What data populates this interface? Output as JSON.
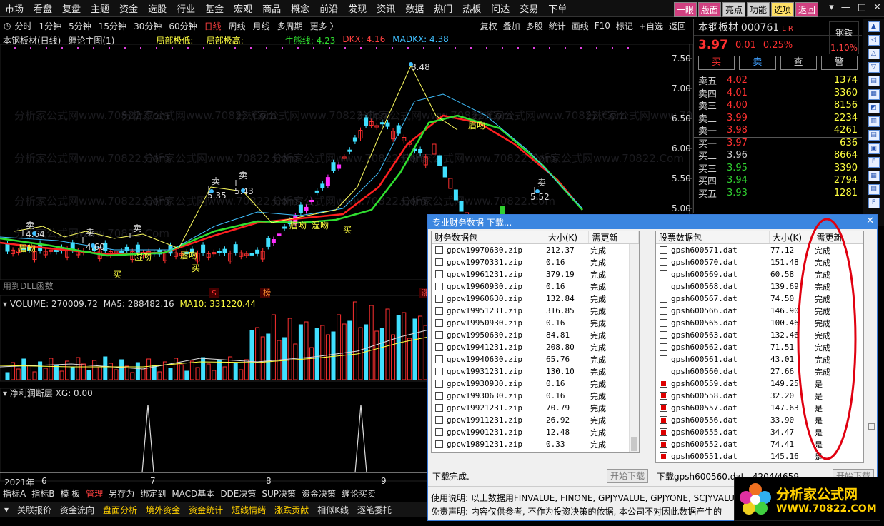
{
  "menu": [
    "市场",
    "看盘",
    "复盘",
    "主题",
    "资金",
    "选股",
    "行业",
    "基金",
    "宏观",
    "商品",
    "概念",
    "前沿",
    "发现",
    "资讯",
    "数据",
    "热门",
    "热板",
    "问达",
    "交易",
    "下单"
  ],
  "top_buttons": [
    {
      "label": "一眼",
      "style": "hi"
    },
    {
      "label": "版面",
      "style": "hi"
    },
    {
      "label": "亮点",
      "style": ""
    },
    {
      "label": "功能",
      "style": ""
    },
    {
      "label": "选项",
      "style": "y"
    },
    {
      "label": "返回",
      "style": "hi"
    }
  ],
  "periods": [
    "分时",
    "1分钟",
    "5分钟",
    "15分钟",
    "30分钟",
    "60分钟",
    "日线",
    "周线",
    "月线",
    "多周期",
    "更多 〉"
  ],
  "active_period": "日线",
  "tools": [
    "复权",
    "叠加",
    "多股",
    "统计",
    "画线",
    "F10",
    "标记",
    "+自选",
    "返回"
  ],
  "chart_header": {
    "stock": "本钢板材(日线)",
    "indicator": "缠论主图(1)",
    "low": "局部极低: -",
    "high": "局部极高: -",
    "niu": "牛熊线: 4.23",
    "dkx": "DKX: 4.16",
    "madkx": "MADKX: 4.38"
  },
  "price_axis": [
    "7.50",
    "7.00",
    "6.50",
    "6.00",
    "5.50",
    "5.00"
  ],
  "annotations": {
    "peak": "8.48",
    "sell": "卖",
    "buy": "买",
    "kiss1": "眉吻",
    "kiss2": "湿吻",
    "kiss3": "唇吻",
    "p1": "4.64",
    "p2": "4.60",
    "p3": "5.35",
    "p4": "5.43",
    "p5": "5.52",
    "dll": "用到DLL函数",
    "m1": "$",
    "m2": "榜",
    "m3": "涨"
  },
  "volume": {
    "label": "VOLUME: 270009.72",
    "ma5": "MA5: 288482.16",
    "ma10": "MA10: 331220.44"
  },
  "indicator2": {
    "label": "净利润断层 XG: 0.00"
  },
  "dates": [
    "2021年",
    "6",
    "7",
    "8",
    "9"
  ],
  "quote": {
    "name": "本钢板材",
    "code": "000761",
    "lr": "L R",
    "price": "3.97",
    "change": "0.01",
    "pct": "0.25%",
    "sector": "钢铁",
    "sector_pct": "1.10%"
  },
  "trade_buttons": [
    "买",
    "卖",
    "查",
    "警"
  ],
  "orderbook": [
    {
      "level": "卖五",
      "price": "4.02",
      "vol": "1374",
      "color": "#ff3030"
    },
    {
      "level": "卖四",
      "price": "4.01",
      "vol": "3360",
      "color": "#ff3030"
    },
    {
      "level": "卖三",
      "price": "4.00",
      "vol": "8156",
      "color": "#ff3030"
    },
    {
      "level": "卖二",
      "price": "3.99",
      "vol": "2234",
      "color": "#ff3030"
    },
    {
      "level": "卖一",
      "price": "3.98",
      "vol": "4261",
      "color": "#ff3030"
    },
    {
      "level": "买一",
      "price": "3.97",
      "vol": "636",
      "color": "#ff3030"
    },
    {
      "level": "买二",
      "price": "3.96",
      "vol": "8664",
      "color": "#cccccc"
    },
    {
      "level": "买三",
      "price": "3.95",
      "vol": "3390",
      "color": "#30d030"
    },
    {
      "level": "买四",
      "price": "3.94",
      "vol": "2794",
      "color": "#30d030"
    },
    {
      "level": "买五",
      "price": "3.93",
      "vol": "1281",
      "color": "#30d030"
    }
  ],
  "bottom_tabs1": [
    "指标A",
    "指标B",
    "模 板",
    "管理",
    "另存为",
    "绑定到",
    "MACD基本",
    "DDE决策",
    "SUP决策",
    "资金决策",
    "缠论买卖"
  ],
  "bottom_tabs2": [
    "关联报价",
    "资金流向",
    "盘面分析",
    "境外资金",
    "资金统计",
    "短线情绪",
    "涨跌贡献",
    "相似K线",
    "逐笔委托"
  ],
  "dialog": {
    "title": "专业财务数据 下载...",
    "left_headers": [
      "财务数据包",
      "大小(K)",
      "需更新"
    ],
    "right_headers": [
      "股票数据包",
      "大小(K)",
      "需更新"
    ],
    "left_rows": [
      {
        "file": "gpcw19970630.zip",
        "size": "212.37",
        "status": "完成"
      },
      {
        "file": "gpcw19970331.zip",
        "size": "0.16",
        "status": "完成"
      },
      {
        "file": "gpcw19961231.zip",
        "size": "379.19",
        "status": "完成"
      },
      {
        "file": "gpcw19960930.zip",
        "size": "0.16",
        "status": "完成"
      },
      {
        "file": "gpcw19960630.zip",
        "size": "132.84",
        "status": "完成"
      },
      {
        "file": "gpcw19951231.zip",
        "size": "316.85",
        "status": "完成"
      },
      {
        "file": "gpcw19950930.zip",
        "size": "0.16",
        "status": "完成"
      },
      {
        "file": "gpcw19950630.zip",
        "size": "84.81",
        "status": "完成"
      },
      {
        "file": "gpcw19941231.zip",
        "size": "208.80",
        "status": "完成"
      },
      {
        "file": "gpcw19940630.zip",
        "size": "65.76",
        "status": "完成"
      },
      {
        "file": "gpcw19931231.zip",
        "size": "130.10",
        "status": "完成"
      },
      {
        "file": "gpcw19930930.zip",
        "size": "0.16",
        "status": "完成"
      },
      {
        "file": "gpcw19930630.zip",
        "size": "0.16",
        "status": "完成"
      },
      {
        "file": "gpcw19921231.zip",
        "size": "70.79",
        "status": "完成"
      },
      {
        "file": "gpcw19911231.zip",
        "size": "26.92",
        "status": "完成"
      },
      {
        "file": "gpcw19901231.zip",
        "size": "12.48",
        "status": "完成"
      },
      {
        "file": "gpcw19891231.zip",
        "size": "0.33",
        "status": "完成"
      }
    ],
    "right_rows": [
      {
        "file": "gpsh600571.dat",
        "size": "77.12",
        "status": "完成",
        "checked": false
      },
      {
        "file": "gpsh600570.dat",
        "size": "151.48",
        "status": "完成",
        "checked": false
      },
      {
        "file": "gpsh600569.dat",
        "size": "60.58",
        "status": "完成",
        "checked": false
      },
      {
        "file": "gpsh600568.dat",
        "size": "139.69",
        "status": "完成",
        "checked": false
      },
      {
        "file": "gpsh600567.dat",
        "size": "74.50",
        "status": "完成",
        "checked": false
      },
      {
        "file": "gpsh600566.dat",
        "size": "146.90",
        "status": "完成",
        "checked": false
      },
      {
        "file": "gpsh600565.dat",
        "size": "100.46",
        "status": "完成",
        "checked": false
      },
      {
        "file": "gpsh600563.dat",
        "size": "132.46",
        "status": "完成",
        "checked": false
      },
      {
        "file": "gpsh600562.dat",
        "size": "71.51",
        "status": "完成",
        "checked": false
      },
      {
        "file": "gpsh600561.dat",
        "size": "43.01",
        "status": "完成",
        "checked": false
      },
      {
        "file": "gpsh600560.dat",
        "size": "27.66",
        "status": "完成",
        "checked": false
      },
      {
        "file": "gpsh600559.dat",
        "size": "149.25",
        "status": "是",
        "checked": true
      },
      {
        "file": "gpsh600558.dat",
        "size": "32.20",
        "status": "是",
        "checked": true
      },
      {
        "file": "gpsh600557.dat",
        "size": "147.63",
        "status": "是",
        "checked": true
      },
      {
        "file": "gpsh600556.dat",
        "size": "33.90",
        "status": "是",
        "checked": true
      },
      {
        "file": "gpsh600555.dat",
        "size": "34.47",
        "status": "是",
        "checked": true
      },
      {
        "file": "gpsh600552.dat",
        "size": "74.41",
        "status": "是",
        "checked": true
      },
      {
        "file": "gpsh600551.dat",
        "size": "145.16",
        "status": "是",
        "checked": true
      }
    ],
    "left_status": "下载完成.",
    "right_status": "下载gpsh600560.dat...4204/4659",
    "start_btn": "开始下载",
    "note1": "使用说明: 以上数据用FINVALUE, FINONE, GPJYVALUE, GPJYONE, SCJYVALUE, SCJYONE",
    "note2": "免责声明: 内容仅供参考, 不作为投资决策的依据, 本公司不对因此数据产生的"
  },
  "logo": {
    "text": "分析家公式网",
    "url": "WWW.70822.COM"
  },
  "watermark": "分析家公式网www.70822.Com"
}
